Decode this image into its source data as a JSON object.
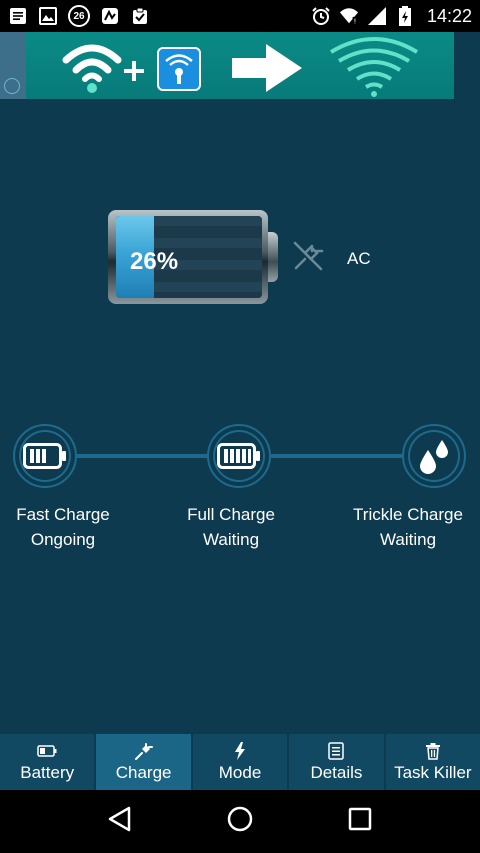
{
  "status_bar": {
    "notification_count": "26",
    "time": "14:22"
  },
  "battery": {
    "percent_label": "26%",
    "level_fraction": 0.26,
    "source": "AC"
  },
  "stages": [
    {
      "title": "Fast Charge",
      "status": "Ongoing",
      "icon": "battery-low-icon"
    },
    {
      "title": "Full Charge",
      "status": "Waiting",
      "icon": "battery-full-icon"
    },
    {
      "title": "Trickle Charge",
      "status": "Waiting",
      "icon": "drops-icon"
    }
  ],
  "tabs": [
    {
      "label": "Battery",
      "icon": "battery-icon"
    },
    {
      "label": "Charge",
      "icon": "plug-icon",
      "active": true
    },
    {
      "label": "Mode",
      "icon": "lightning-icon"
    },
    {
      "label": "Details",
      "icon": "list-icon"
    },
    {
      "label": "Task Killer",
      "icon": "trash-icon"
    }
  ],
  "colors": {
    "background": "#0d3a4f",
    "accent": "#3aa4d6",
    "tab_active": "#1b6587"
  }
}
